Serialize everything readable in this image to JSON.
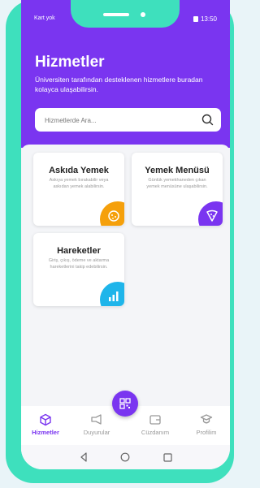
{
  "status_bar": {
    "carrier": "Kart yok",
    "time": "13:50"
  },
  "header": {
    "title": "Hizmetler",
    "subtitle": "Üniversiten tarafından desteklenen hizmetlere buradan kolayca ulaşabilirsin."
  },
  "search": {
    "placeholder": "Hizmetlerde Ara..."
  },
  "cards": [
    {
      "title": "Askıda Yemek",
      "description": "Askıya yemek bırakabilir veya askıdan yemek alabilirsin.",
      "icon": "food-icon",
      "color": "#f5a00b"
    },
    {
      "title": "Yemek Menüsü",
      "description": "Günlük yemekhaneden çıkan yemek menüsüne ulaşabilirsin.",
      "icon": "pizza-icon",
      "color": "#7a35f0"
    },
    {
      "title": "Hareketler",
      "description": "Giriş, çıkış, ödeme ve aktarma hareketlerini takip edebilirsin.",
      "icon": "chart-icon",
      "color": "#1fb5ea"
    }
  ],
  "bottom_nav": [
    {
      "label": "Hizmetler",
      "icon": "cube-icon",
      "active": true
    },
    {
      "label": "Duyurular",
      "icon": "megaphone-icon",
      "active": false
    },
    {
      "label": "Cüzdanım",
      "icon": "wallet-icon",
      "active": false
    },
    {
      "label": "Profilim",
      "icon": "graduate-icon",
      "active": false
    }
  ],
  "colors": {
    "brand": "#7a35f0",
    "frame": "#3ee0bd"
  }
}
